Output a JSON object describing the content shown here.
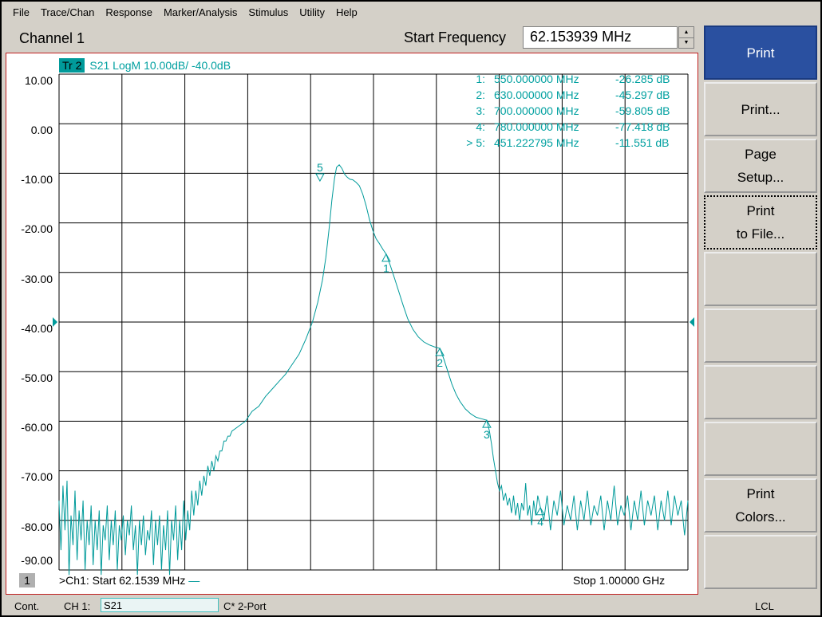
{
  "menu": [
    "File",
    "Trace/Chan",
    "Response",
    "Marker/Analysis",
    "Stimulus",
    "Utility",
    "Help"
  ],
  "toolbar": {
    "channel_title": "Channel 1",
    "start_freq_label": "Start Frequency",
    "start_freq_value": "62.153939 MHz"
  },
  "trace": {
    "tr_box": "Tr 2",
    "label": "S21 LogM 10.00dB/  -40.0dB",
    "color": "#009a9a"
  },
  "y_ticks": [
    "10.00",
    "0.00",
    "-10.00",
    "-20.00",
    "-30.00",
    "-40.00",
    "-50.00",
    "-60.00",
    "-70.00",
    "-80.00",
    "-90.00"
  ],
  "markers": [
    {
      "id": "1:",
      "freq": "550.000000 MHz",
      "value": "-26.285 dB"
    },
    {
      "id": "2:",
      "freq": "630.000000 MHz",
      "value": "-45.297 dB"
    },
    {
      "id": "3:",
      "freq": "700.000000 MHz",
      "value": "-59.805 dB"
    },
    {
      "id": "4:",
      "freq": "780.000000 MHz",
      "value": "-77.418 dB"
    },
    {
      "id": "> 5:",
      "freq": "451.222795 MHz",
      "value": "-11.551 dB"
    }
  ],
  "footer": {
    "channel_number": "1",
    "start_text": ">Ch1: Start  62.1539 MHz",
    "stop_text": "Stop  1.00000 GHz"
  },
  "side_buttons": [
    {
      "label": "Print",
      "active": true
    },
    {
      "label": "Print...",
      "active": false
    },
    {
      "label": "Page\nSetup...",
      "active": false
    },
    {
      "label": "Print\nto File...",
      "active": false,
      "pressed": true
    },
    {
      "label": "",
      "active": false
    },
    {
      "label": "",
      "active": false
    },
    {
      "label": "",
      "active": false
    },
    {
      "label": "",
      "active": false
    },
    {
      "label": "Print\nColors...",
      "active": false
    },
    {
      "label": "",
      "active": false
    }
  ],
  "status": {
    "mode": "Cont.",
    "channel": "CH 1:",
    "param": "S21",
    "cal": "C* 2-Port",
    "remote": "LCL"
  },
  "chart_data": {
    "type": "line",
    "title": "",
    "xlabel": "",
    "ylabel": "",
    "x_unit": "MHz",
    "y_unit": "dB",
    "xlim": [
      62.1539,
      1000
    ],
    "ylim": [
      -90,
      10
    ],
    "y_ref": -40,
    "y_scale_per_div": 10,
    "grid": true,
    "series": [
      {
        "name": "S21",
        "points": [
          [
            62,
            -76
          ],
          [
            65,
            -86
          ],
          [
            68,
            -73
          ],
          [
            71,
            -82
          ],
          [
            74,
            -72
          ],
          [
            77,
            -91
          ],
          [
            80,
            -79
          ],
          [
            83,
            -85
          ],
          [
            86,
            -74
          ],
          [
            89,
            -88
          ],
          [
            92,
            -78
          ],
          [
            95,
            -84
          ],
          [
            98,
            -76
          ],
          [
            101,
            -90
          ],
          [
            104,
            -80
          ],
          [
            107,
            -85
          ],
          [
            110,
            -77
          ],
          [
            113,
            -89
          ],
          [
            116,
            -80
          ],
          [
            119,
            -86
          ],
          [
            122,
            -78
          ],
          [
            125,
            -91
          ],
          [
            128,
            -81
          ],
          [
            131,
            -84
          ],
          [
            134,
            -77
          ],
          [
            137,
            -88
          ],
          [
            140,
            -80
          ],
          [
            143,
            -85
          ],
          [
            146,
            -78
          ],
          [
            149,
            -90
          ],
          [
            152,
            -81
          ],
          [
            155,
            -84
          ],
          [
            158,
            -79
          ],
          [
            161,
            -87
          ],
          [
            164,
            -80
          ],
          [
            167,
            -83
          ],
          [
            170,
            -77
          ],
          [
            173,
            -86
          ],
          [
            176,
            -81
          ],
          [
            179,
            -91
          ],
          [
            182,
            -80
          ],
          [
            185,
            -85
          ],
          [
            188,
            -79
          ],
          [
            191,
            -87
          ],
          [
            194,
            -82
          ],
          [
            197,
            -84
          ],
          [
            200,
            -78
          ],
          [
            203,
            -89
          ],
          [
            206,
            -80
          ],
          [
            209,
            -85
          ],
          [
            212,
            -79
          ],
          [
            215,
            -90
          ],
          [
            218,
            -81
          ],
          [
            221,
            -86
          ],
          [
            224,
            -78
          ],
          [
            227,
            -91
          ],
          [
            230,
            -80
          ],
          [
            233,
            -84
          ],
          [
            236,
            -77
          ],
          [
            239,
            -88
          ],
          [
            242,
            -80
          ],
          [
            245,
            -86
          ],
          [
            248,
            -76
          ],
          [
            251,
            -84
          ],
          [
            254,
            -78
          ],
          [
            257,
            -82
          ],
          [
            260,
            -74
          ],
          [
            263,
            -79
          ],
          [
            266,
            -74
          ],
          [
            269,
            -77
          ],
          [
            272,
            -72
          ],
          [
            275,
            -75
          ],
          [
            278,
            -71
          ],
          [
            281,
            -73
          ],
          [
            284,
            -69
          ],
          [
            287,
            -71
          ],
          [
            290,
            -68
          ],
          [
            293,
            -70
          ],
          [
            296,
            -67
          ],
          [
            299,
            -68
          ],
          [
            302,
            -66
          ],
          [
            305,
            -66
          ],
          [
            308,
            -64
          ],
          [
            311,
            -64
          ],
          [
            314,
            -63
          ],
          [
            317,
            -63
          ],
          [
            320,
            -62
          ],
          [
            330,
            -61
          ],
          [
            340,
            -60
          ],
          [
            350,
            -58
          ],
          [
            360,
            -57
          ],
          [
            370,
            -55
          ],
          [
            380,
            -53.5
          ],
          [
            390,
            -52
          ],
          [
            400,
            -50.5
          ],
          [
            410,
            -48.5
          ],
          [
            420,
            -46.5
          ],
          [
            430,
            -43.5
          ],
          [
            440,
            -40
          ],
          [
            448,
            -36
          ],
          [
            455,
            -31.5
          ],
          [
            460,
            -27
          ],
          [
            465,
            -21
          ],
          [
            469,
            -15.5
          ],
          [
            473,
            -11
          ],
          [
            476,
            -8.8
          ],
          [
            480,
            -8.3
          ],
          [
            484,
            -9
          ],
          [
            488,
            -10.2
          ],
          [
            492,
            -10.8
          ],
          [
            496,
            -11.2
          ],
          [
            500,
            -11.3
          ],
          [
            505,
            -11.8
          ],
          [
            510,
            -12.5
          ],
          [
            515,
            -14.2
          ],
          [
            520,
            -16.5
          ],
          [
            525,
            -19.3
          ],
          [
            530,
            -21.5
          ],
          [
            535,
            -23.2
          ],
          [
            540,
            -24.2
          ],
          [
            545,
            -25.3
          ],
          [
            550,
            -26.3
          ],
          [
            556,
            -28.5
          ],
          [
            562,
            -31
          ],
          [
            568,
            -33.5
          ],
          [
            575,
            -36.5
          ],
          [
            582,
            -39.3
          ],
          [
            590,
            -41.5
          ],
          [
            598,
            -43
          ],
          [
            606,
            -44
          ],
          [
            614,
            -44.6
          ],
          [
            622,
            -45
          ],
          [
            630,
            -45.3
          ],
          [
            636,
            -47.5
          ],
          [
            642,
            -50
          ],
          [
            648,
            -52.5
          ],
          [
            654,
            -54.5
          ],
          [
            660,
            -56
          ],
          [
            668,
            -57.5
          ],
          [
            676,
            -58.5
          ],
          [
            684,
            -59.2
          ],
          [
            692,
            -59.5
          ],
          [
            700,
            -59.8
          ],
          [
            704,
            -62
          ],
          [
            707,
            -64.5
          ],
          [
            710,
            -67.5
          ],
          [
            713,
            -70
          ],
          [
            716,
            -72.5
          ],
          [
            719,
            -74
          ],
          [
            722,
            -73
          ],
          [
            725,
            -76
          ],
          [
            728,
            -74.5
          ],
          [
            731,
            -77
          ],
          [
            734,
            -75.5
          ],
          [
            737,
            -78.5
          ],
          [
            740,
            -75
          ],
          [
            743,
            -79
          ],
          [
            746,
            -76.5
          ],
          [
            749,
            -80
          ],
          [
            752,
            -76.5
          ],
          [
            755,
            -78
          ],
          [
            758,
            -72.5
          ],
          [
            761,
            -79
          ],
          [
            764,
            -77
          ],
          [
            767,
            -81
          ],
          [
            770,
            -76
          ],
          [
            773,
            -79
          ],
          [
            776,
            -75
          ],
          [
            780,
            -77.4
          ],
          [
            785,
            -80
          ],
          [
            790,
            -75
          ],
          [
            795,
            -82
          ],
          [
            800,
            -76
          ],
          [
            805,
            -79
          ],
          [
            810,
            -74
          ],
          [
            815,
            -81
          ],
          [
            820,
            -77
          ],
          [
            825,
            -80
          ],
          [
            830,
            -75
          ],
          [
            835,
            -82
          ],
          [
            840,
            -76
          ],
          [
            845,
            -80
          ],
          [
            850,
            -74
          ],
          [
            855,
            -81
          ],
          [
            860,
            -77
          ],
          [
            865,
            -79
          ],
          [
            870,
            -75
          ],
          [
            875,
            -82
          ],
          [
            880,
            -76
          ],
          [
            885,
            -80
          ],
          [
            890,
            -73
          ],
          [
            895,
            -81
          ],
          [
            900,
            -77
          ],
          [
            905,
            -79
          ],
          [
            910,
            -75
          ],
          [
            915,
            -82
          ],
          [
            920,
            -76
          ],
          [
            925,
            -80
          ],
          [
            930,
            -74
          ],
          [
            935,
            -81
          ],
          [
            940,
            -76
          ],
          [
            945,
            -79
          ],
          [
            950,
            -75
          ],
          [
            955,
            -82
          ],
          [
            960,
            -76
          ],
          [
            965,
            -80
          ],
          [
            970,
            -74
          ],
          [
            975,
            -81
          ],
          [
            980,
            -75
          ],
          [
            985,
            -79
          ],
          [
            990,
            -76
          ],
          [
            995,
            -83
          ],
          [
            1000,
            -76
          ]
        ]
      }
    ],
    "markers": [
      {
        "label": "1",
        "x": 550,
        "y": -26.285
      },
      {
        "label": "2",
        "x": 630,
        "y": -45.297
      },
      {
        "label": "3",
        "x": 700,
        "y": -59.805
      },
      {
        "label": "4",
        "x": 780,
        "y": -77.418
      },
      {
        "label": "5",
        "x": 451.222795,
        "y": -11.551
      }
    ]
  }
}
